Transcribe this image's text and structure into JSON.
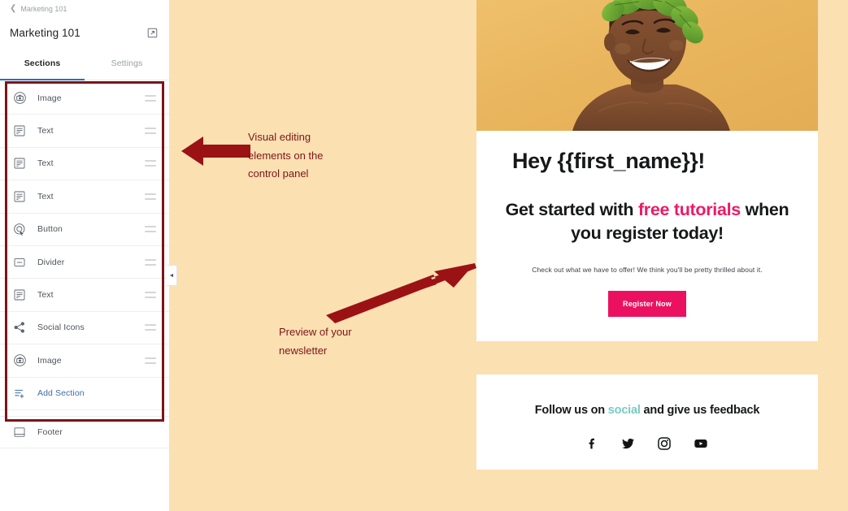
{
  "sidebar": {
    "breadcrumb": {
      "icon": "chevron-left-icon",
      "label": "Marketing 101"
    },
    "doc_title": "Marketing 101",
    "edit_icon": "external-link-edit-icon",
    "tabs": [
      {
        "label": "Sections",
        "active": true
      },
      {
        "label": "Settings",
        "active": false
      }
    ],
    "sections": [
      {
        "label": "Image",
        "icon": "camera-circle-icon",
        "draggable": true
      },
      {
        "label": "Text",
        "icon": "text-block-icon",
        "draggable": true
      },
      {
        "label": "Text",
        "icon": "text-block-icon",
        "draggable": true
      },
      {
        "label": "Text",
        "icon": "text-block-icon",
        "draggable": true
      },
      {
        "label": "Button",
        "icon": "button-cursor-icon",
        "draggable": true
      },
      {
        "label": "Divider",
        "icon": "divider-icon",
        "draggable": true
      },
      {
        "label": "Text",
        "icon": "text-block-icon",
        "draggable": true
      },
      {
        "label": "Social Icons",
        "icon": "share-nodes-icon",
        "draggable": true
      },
      {
        "label": "Image",
        "icon": "camera-circle-icon",
        "draggable": true
      }
    ],
    "add_section": {
      "label": "Add Section",
      "icon": "add-section-icon"
    },
    "footer_item": {
      "label": "Footer",
      "icon": "footer-block-icon"
    },
    "collapse_handle": {
      "icon": "chevron-left-icon"
    }
  },
  "annotations": [
    {
      "id": "sidebar",
      "text": "Visual editing\n elements on the\ncontrol panel"
    },
    {
      "id": "preview",
      "text": "Preview of your\nnewsletter"
    }
  ],
  "preview": {
    "hero_alt": "smiling-woman-with-leaf-crown-photo",
    "greeting": "Hey {{first_name}}!",
    "headline": {
      "part1": "Get started with ",
      "highlight1": "free tutorials",
      "part2": " when you register today!"
    },
    "subcopy": "Check out what we have to offer! We think you'll be pretty thrilled about it.",
    "cta_label": "Register Now",
    "footer": {
      "follow_prefix": "Follow us on ",
      "follow_highlight": "social",
      "follow_suffix": " and give us feedback",
      "social_icons": [
        "facebook-icon",
        "twitter-icon",
        "instagram-icon",
        "youtube-icon"
      ]
    }
  },
  "colors": {
    "canvas_bg": "#fbe0b2",
    "annotation_red": "#7d1418",
    "accent_pink": "#ec1160",
    "accent_teal": "#76ccc0",
    "tab_blue": "#2f6fb5",
    "link_blue": "#3f6ea8"
  }
}
